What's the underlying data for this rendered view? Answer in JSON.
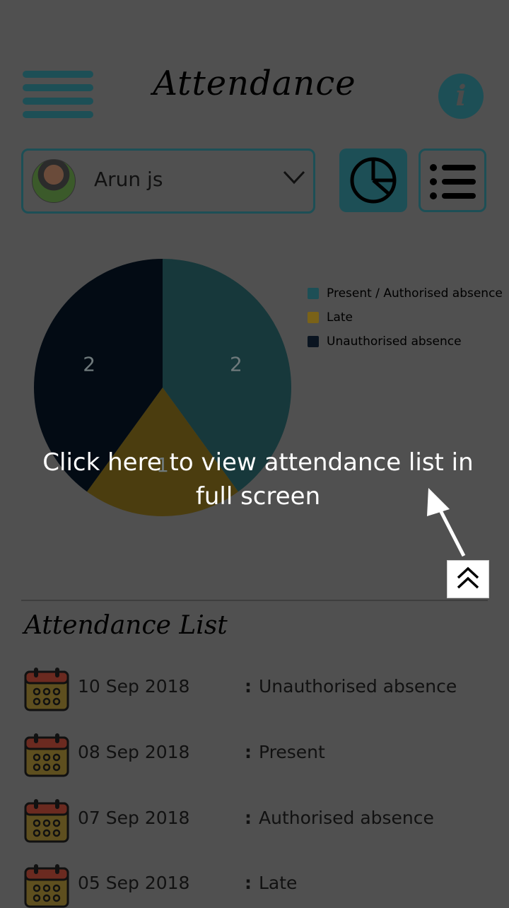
{
  "header": {
    "title": "Attendance"
  },
  "student_select": {
    "selected": "Arun js"
  },
  "icons": {
    "menu": "hamburger-menu-icon",
    "info": "info-icon",
    "chevron": "chevron-down-icon",
    "pie": "pie-chart-icon",
    "list": "list-icon",
    "expand": "double-chevron-up-icon",
    "calendar": "calendar-icon"
  },
  "colors": {
    "accent": "#1d4f56",
    "present": "#17383b",
    "late": "#4b3d0f",
    "unauthorised": "#030b14"
  },
  "chart_data": {
    "type": "pie",
    "series": [
      {
        "name": "Present / Authorised absence",
        "value": 2
      },
      {
        "name": "Late",
        "value": 1
      },
      {
        "name": "Unauthorised absence",
        "value": 2
      }
    ],
    "legend_position": "right"
  },
  "tooltip": {
    "text": "Click here to view attendance list in full screen"
  },
  "attendance_list": {
    "title": "Attendance List",
    "rows": [
      {
        "date": "10 Sep 2018",
        "status": "Unauthorised absence"
      },
      {
        "date": "08 Sep 2018",
        "status": "Present"
      },
      {
        "date": "07 Sep 2018",
        "status": "Authorised absence"
      },
      {
        "date": "05 Sep 2018",
        "status": "Late"
      }
    ],
    "separator": ":"
  }
}
